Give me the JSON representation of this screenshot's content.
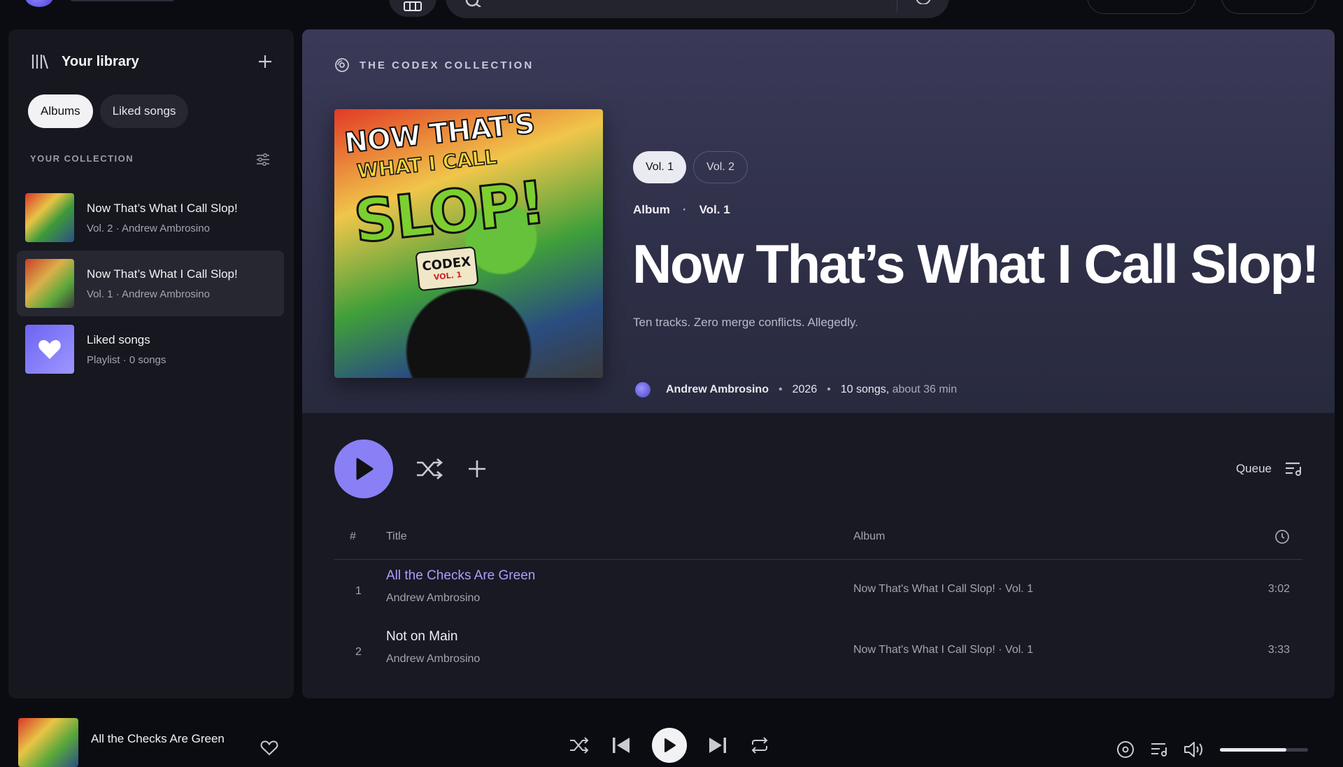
{
  "sidebar": {
    "title": "Your library",
    "chips": [
      "Albums",
      "Liked songs"
    ],
    "collection_label": "YOUR COLLECTION",
    "items": [
      {
        "title": "Now That’s What I Call Slop!",
        "subtitle": "Vol. 2 · Andrew Ambrosino"
      },
      {
        "title": "Now That’s What I Call Slop!",
        "subtitle": "Vol. 1 · Andrew Ambrosino"
      },
      {
        "title": "Liked songs",
        "subtitle": "Playlist · 0 songs"
      }
    ]
  },
  "album": {
    "collection": "THE CODEX COLLECTION",
    "volumes": [
      "Vol. 1",
      "Vol. 2"
    ],
    "type": "Album",
    "volume": "Vol. 1",
    "title": "Now That’s What I Call Slop!",
    "description": "Ten tracks. Zero merge conflicts. Allegedly.",
    "artist": "Andrew Ambrosino",
    "year": "2026",
    "song_count": "10 songs,",
    "duration": "about 36 min",
    "cover_text": {
      "line1": "NOW THAT'S",
      "line2": "WHAT I CALL",
      "line3": "SLOP!",
      "badge": "CODEX",
      "badge_vol": "VOL. 1"
    }
  },
  "actions": {
    "queue_label": "Queue"
  },
  "table": {
    "headers": {
      "num": "#",
      "title": "Title",
      "album": "Album"
    },
    "tracks": [
      {
        "num": "1",
        "title": "All the Checks Are Green",
        "artist": "Andrew Ambrosino",
        "album": "Now That's What I Call Slop! · Vol. 1",
        "duration": "3:02"
      },
      {
        "num": "2",
        "title": "Not on Main",
        "artist": "Andrew Ambrosino",
        "album": "Now That's What I Call Slop! · Vol. 1",
        "duration": "3:33"
      }
    ]
  },
  "player": {
    "now_playing": "All the Checks Are Green",
    "volume_fraction": 0.75
  },
  "colors": {
    "accent": "#8a80f5",
    "playing_title": "#a79fff",
    "background": "#0b0c12"
  }
}
